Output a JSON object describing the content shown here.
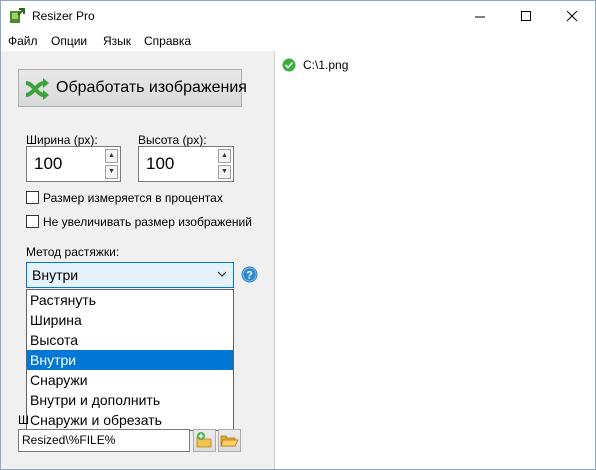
{
  "window": {
    "title": "Resizer Pro"
  },
  "menu": [
    "Файл",
    "Опции",
    "Язык",
    "Справка"
  ],
  "process_button": {
    "label": "Обработать изображения"
  },
  "width_field": {
    "label": "Ширина (px):",
    "value": "100"
  },
  "height_field": {
    "label": "Высота (px):",
    "value": "100"
  },
  "options": {
    "percent_label": "Размер измеряется в процентах",
    "no_upscale_label": "Не увеличивать размер изображений"
  },
  "stretch": {
    "label": "Метод растяжки:",
    "selected": "Внутри",
    "items": [
      "Растянуть",
      "Ширина",
      "Высота",
      "Внутри",
      "Снаружи",
      "Внутри и дополнить",
      "Снаружи и обрезать"
    ]
  },
  "output": {
    "label_partial": "Ш",
    "path_value": "Resized\\%FILE%"
  },
  "files": [
    {
      "name": "C:\\1.png",
      "status": "ok"
    }
  ],
  "colors": {
    "accent": "#0078d7",
    "ok": "#3cae3c",
    "help": "#2c8ad1"
  }
}
